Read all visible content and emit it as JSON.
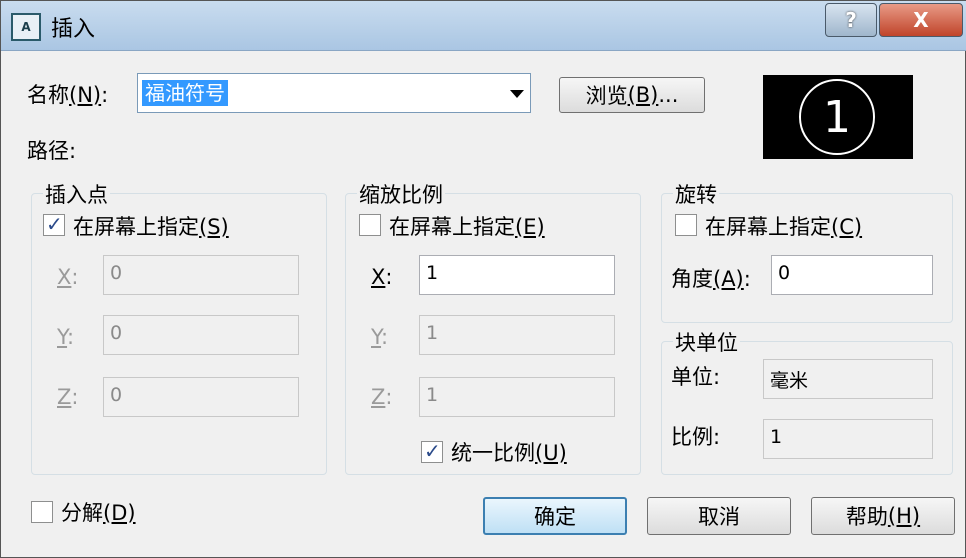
{
  "window": {
    "title": "插入",
    "app_icon_text": "A",
    "help_button": "?",
    "close_button": "X"
  },
  "name": {
    "label": "名称",
    "mnemonic": "(N)",
    "colon": ":",
    "value": "福油符号",
    "browse_label": "浏览",
    "browse_mnemonic": "(B)",
    "browse_suffix": "..."
  },
  "path": {
    "label": "路径:"
  },
  "preview": {
    "symbol": "1"
  },
  "insertion_point": {
    "title": "插入点",
    "specify_label": "在屏幕上指定",
    "specify_mnemonic": "(S)",
    "specify_checked": true,
    "x_label": "X",
    "y_label": "Y",
    "z_label": "Z",
    "colon": ":",
    "x": "0",
    "y": "0",
    "z": "0"
  },
  "scale": {
    "title": "缩放比例",
    "specify_label": "在屏幕上指定",
    "specify_mnemonic": "(E)",
    "specify_checked": false,
    "x_label": "X",
    "y_label": "Y",
    "z_label": "Z",
    "colon": ":",
    "x": "1",
    "y": "1",
    "z": "1",
    "uniform_label": "统一比例",
    "uniform_mnemonic": "(U)",
    "uniform_checked": true
  },
  "rotation": {
    "title": "旋转",
    "specify_label": "在屏幕上指定",
    "specify_mnemonic": "(C)",
    "specify_checked": false,
    "angle_label": "角度",
    "angle_mnemonic": "(A)",
    "colon": ":",
    "angle": "0"
  },
  "block_unit": {
    "title": "块单位",
    "unit_label": "单位:",
    "unit_value": "毫米",
    "factor_label": "比例:",
    "factor_value": "1"
  },
  "explode": {
    "label": "分解",
    "mnemonic": "(D)",
    "checked": false
  },
  "buttons": {
    "ok": "确定",
    "cancel": "取消",
    "help": "帮助",
    "help_mnemonic": "(H)"
  },
  "colors": {
    "selection": "#3399ff",
    "close": "#c0442a",
    "title_bar": "#aac6e3"
  }
}
